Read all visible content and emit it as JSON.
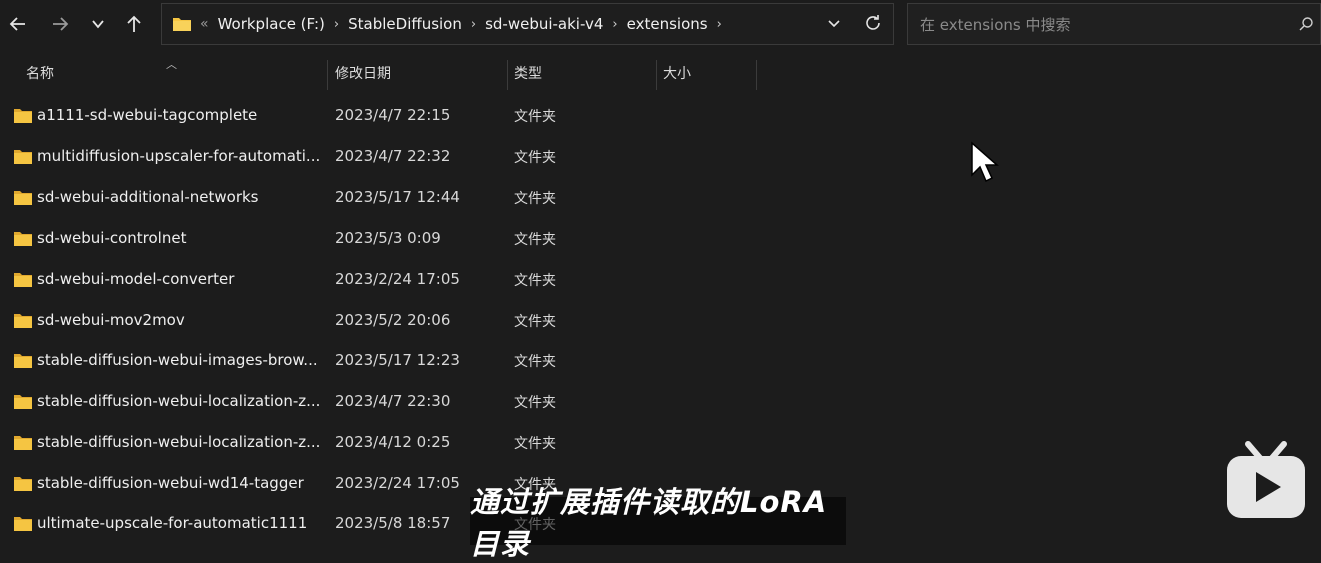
{
  "toolbar": {
    "back_icon": "arrow-left-icon",
    "forward_icon": "arrow-right-icon",
    "recent_icon": "chevron-down-icon",
    "up_icon": "arrow-up-icon"
  },
  "address": {
    "overflow": "«",
    "crumbs": [
      "Workplace (F:)",
      "StableDiffusion",
      "sd-webui-aki-v4",
      "extensions"
    ]
  },
  "search": {
    "placeholder": "在 extensions 中搜索"
  },
  "columns": {
    "name": "名称",
    "date": "修改日期",
    "type": "类型",
    "size": "大小"
  },
  "files": [
    {
      "name": "a1111-sd-webui-tagcomplete",
      "date": "2023/4/7 22:15",
      "type": "文件夹"
    },
    {
      "name": "multidiffusion-upscaler-for-automati...",
      "date": "2023/4/7 22:32",
      "type": "文件夹"
    },
    {
      "name": "sd-webui-additional-networks",
      "date": "2023/5/17 12:44",
      "type": "文件夹"
    },
    {
      "name": "sd-webui-controlnet",
      "date": "2023/5/3 0:09",
      "type": "文件夹"
    },
    {
      "name": "sd-webui-model-converter",
      "date": "2023/2/24 17:05",
      "type": "文件夹"
    },
    {
      "name": "sd-webui-mov2mov",
      "date": "2023/5/2 20:06",
      "type": "文件夹"
    },
    {
      "name": "stable-diffusion-webui-images-brow...",
      "date": "2023/5/17 12:23",
      "type": "文件夹"
    },
    {
      "name": "stable-diffusion-webui-localization-z...",
      "date": "2023/4/7 22:30",
      "type": "文件夹"
    },
    {
      "name": "stable-diffusion-webui-localization-z...",
      "date": "2023/4/12 0:25",
      "type": "文件夹"
    },
    {
      "name": "stable-diffusion-webui-wd14-tagger",
      "date": "2023/2/24 17:05",
      "type": "文件夹"
    },
    {
      "name": "ultimate-upscale-for-automatic1111",
      "date": "2023/5/8 18:57",
      "type": "文件夹"
    }
  ],
  "subtitle": "通过扩展插件读取的LoRA目录",
  "colors": {
    "folder": "#f5c542",
    "background": "#1c1c1c",
    "bilibili": "#e6e6e6"
  }
}
